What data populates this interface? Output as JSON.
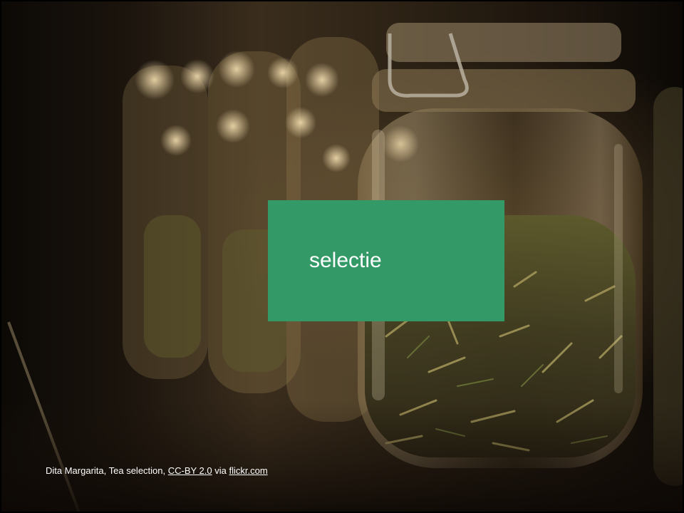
{
  "slide": {
    "title": "selectie",
    "title_box_color": "#339966"
  },
  "caption": {
    "prefix": "Dita Margarita, Tea selection, ",
    "license_link": "CC-BY 2.0",
    "middle": " via ",
    "source_link": "flickr.com"
  },
  "background": {
    "subject": "glass jars of loose tea"
  }
}
